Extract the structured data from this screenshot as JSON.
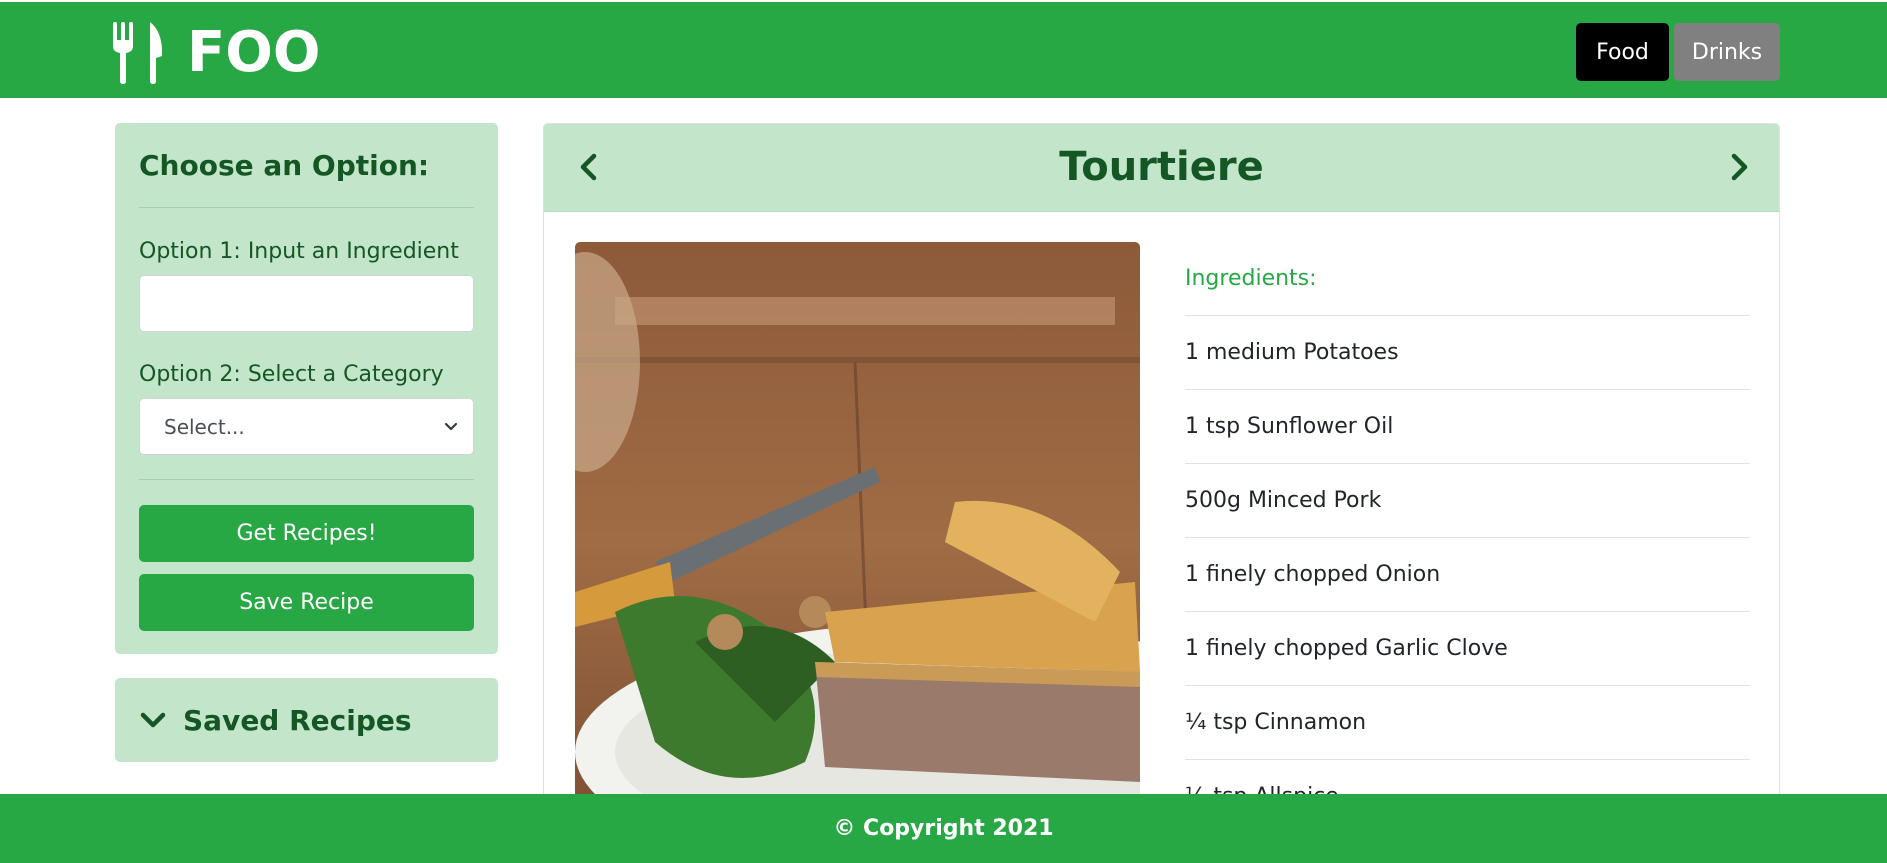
{
  "brand": {
    "name": "FOO",
    "icon": "utensils-icon"
  },
  "nav": {
    "food_label": "Food",
    "drinks_label": "Drinks"
  },
  "sidebar": {
    "title": "Choose an Option:",
    "option1_label": "Option 1: Input an Ingredient",
    "ingredient_input": {
      "value": "",
      "placeholder": ""
    },
    "option2_label": "Option 2: Select a Category",
    "category_select": {
      "selected": "Select..."
    },
    "get_recipes_label": "Get Recipes!",
    "save_recipe_label": "Save Recipe"
  },
  "saved": {
    "label": "Saved Recipes",
    "icon": "chevron-down-icon"
  },
  "recipe": {
    "title": "Tourtiere",
    "prev_icon": "chevron-left-icon",
    "next_icon": "chevron-right-icon",
    "image": "meat-pie-with-salad-photo",
    "ingredients_heading": "Ingredients:",
    "ingredients": [
      "1 medium Potatoes",
      "1 tsp Sunflower Oil",
      "500g Minced Pork",
      "1 finely chopped Onion",
      "1 finely chopped Garlic Clove",
      "¼ tsp Cinnamon",
      "¼ tsp Allspice"
    ]
  },
  "footer": {
    "text": "© Copyright 2021"
  },
  "colors": {
    "primary_green": "#28a745",
    "light_green": "#c3e6cb",
    "dark_green": "#155724",
    "food_button": "#000000",
    "drinks_button": "#808080"
  }
}
